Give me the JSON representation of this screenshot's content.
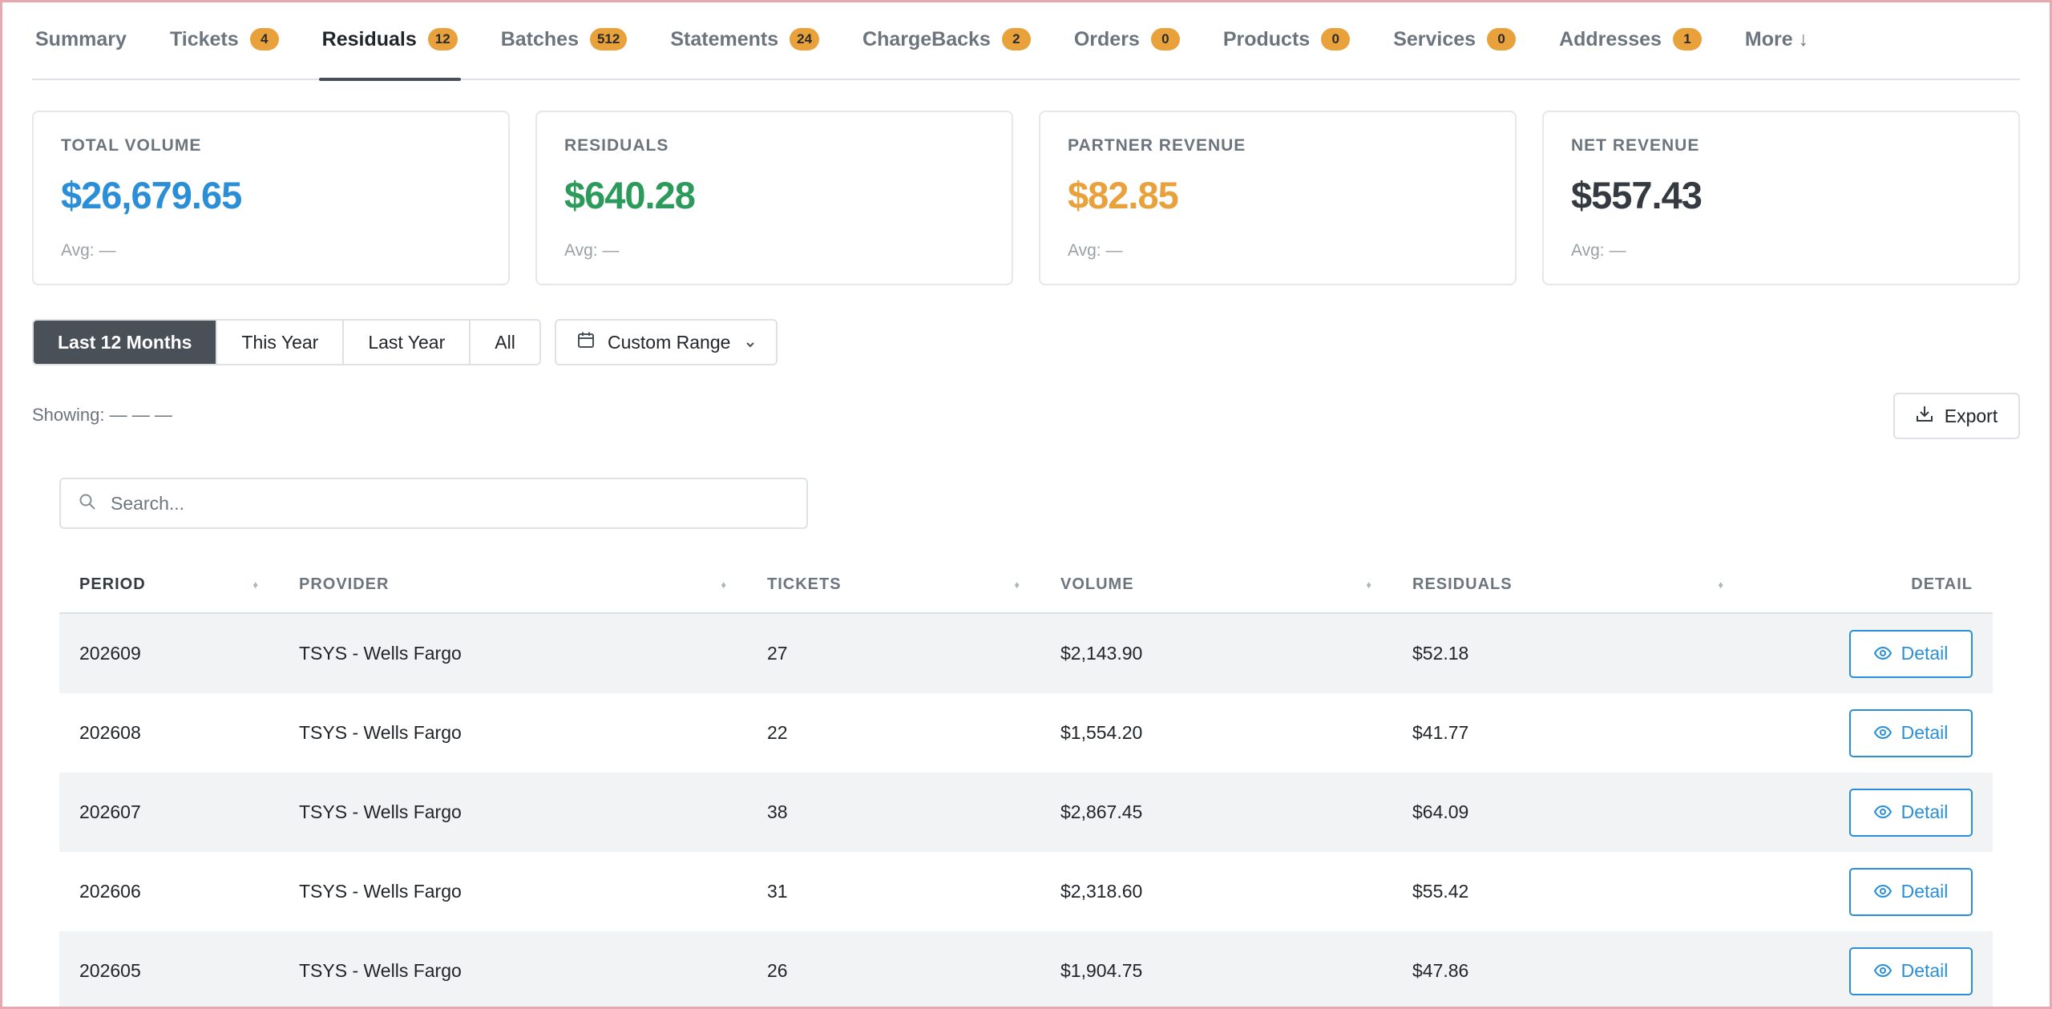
{
  "tabs": [
    {
      "label": "Summary",
      "badge": null
    },
    {
      "label": "Tickets",
      "badge": "4"
    },
    {
      "label": "Residuals",
      "badge": "12",
      "active": true
    },
    {
      "label": "Batches",
      "badge": "512"
    },
    {
      "label": "Statements",
      "badge": "24"
    },
    {
      "label": "ChargeBacks",
      "badge": "2"
    },
    {
      "label": "Orders",
      "badge": "0"
    },
    {
      "label": "Products",
      "badge": "0"
    },
    {
      "label": "Services",
      "badge": "0"
    },
    {
      "label": "Addresses",
      "badge": "1"
    },
    {
      "label": "More ↓",
      "badge": null
    }
  ],
  "cards": [
    {
      "label": "TOTAL VOLUME",
      "value": "$26,679.65",
      "avg": "Avg: —",
      "color": "#2a8fd6"
    },
    {
      "label": "RESIDUALS",
      "value": "$640.28",
      "avg": "Avg: —",
      "color": "#2b9a5a"
    },
    {
      "label": "PARTNER REVENUE",
      "value": "$82.85",
      "avg": "Avg: —",
      "color": "#e9a23b"
    },
    {
      "label": "NET REVENUE",
      "value": "$557.43",
      "avg": "Avg: —",
      "color": "#343a40"
    }
  ],
  "range": {
    "options": [
      "Last 12 Months",
      "This Year",
      "Last Year",
      "All"
    ],
    "active": "Last 12 Months",
    "custom_label": "Custom Range"
  },
  "showing": "Showing: — — —",
  "export_label": "Export",
  "search": {
    "placeholder": "Search..."
  },
  "table": {
    "headers": [
      "PERIOD",
      "PROVIDER",
      "TICKETS",
      "VOLUME",
      "RESIDUALS",
      "DETAIL"
    ],
    "detail_label": "Detail",
    "rows": [
      {
        "period": "202609",
        "provider": "TSYS - Wells Fargo",
        "tickets": "27",
        "volume": "$2,143.90",
        "residuals": "$52.18"
      },
      {
        "period": "202608",
        "provider": "TSYS - Wells Fargo",
        "tickets": "22",
        "volume": "$1,554.20",
        "residuals": "$41.77"
      },
      {
        "period": "202607",
        "provider": "TSYS - Wells Fargo",
        "tickets": "38",
        "volume": "$2,867.45",
        "residuals": "$64.09"
      },
      {
        "period": "202606",
        "provider": "TSYS - Wells Fargo",
        "tickets": "31",
        "volume": "$2,318.60",
        "residuals": "$55.42"
      },
      {
        "period": "202605",
        "provider": "TSYS - Wells Fargo",
        "tickets": "26",
        "volume": "$1,904.75",
        "residuals": "$47.86"
      }
    ]
  }
}
